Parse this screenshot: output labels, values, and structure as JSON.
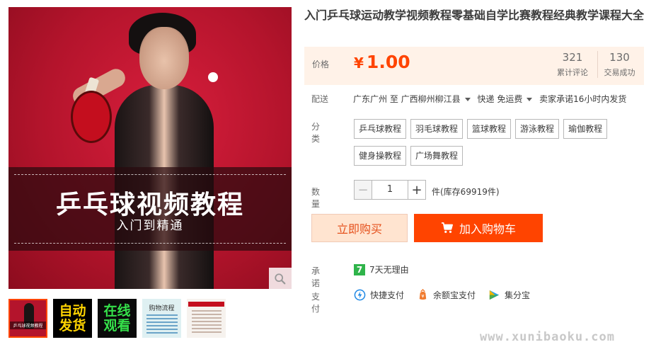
{
  "product": {
    "title": "入门乒乓球运动教学视频教程零基础自学比赛教程经典教学课程大全",
    "image_banner": {
      "title": "乒乓球视频教程",
      "subtitle": "入门到精通"
    },
    "thumbnails": [
      {
        "name": "main-photo",
        "caption": "乒乓球视频教程"
      },
      {
        "name": "auto-delivery",
        "line1": "自动",
        "line2": "发货"
      },
      {
        "name": "online-watch",
        "line1": "在线",
        "line2": "观看"
      },
      {
        "name": "purchase-flow",
        "caption": "购物流程"
      },
      {
        "name": "detail-page",
        "caption": ""
      }
    ]
  },
  "price": {
    "label": "价格",
    "currency": "¥",
    "amount": "1.00",
    "reviews_count": "321",
    "reviews_label": "累计评论",
    "sales_count": "130",
    "sales_label": "交易成功"
  },
  "shipping": {
    "label": "配送",
    "from": "广东广州 至",
    "to": "广西柳州柳江县",
    "method": "快递 免运费",
    "promise": "卖家承诺16小时内发货"
  },
  "category": {
    "label": "分类",
    "options": [
      "乒乓球教程",
      "羽毛球教程",
      "篮球教程",
      "游泳教程",
      "瑜伽教程",
      "健身操教程",
      "广场舞教程"
    ]
  },
  "quantity": {
    "label": "数量",
    "value": "1",
    "minus": "−",
    "plus": "+",
    "stock_text": "件(库存69919件)"
  },
  "actions": {
    "buy_now": "立即购买",
    "add_to_cart": "加入购物车"
  },
  "promise": {
    "label": "承诺",
    "badge": "7",
    "text": "7天无理由"
  },
  "payment": {
    "label": "支付",
    "methods": [
      {
        "name": "快捷支付",
        "icon": "quick-pay-icon"
      },
      {
        "name": "余额宝支付",
        "icon": "yuebao-icon"
      },
      {
        "name": "集分宝",
        "icon": "jifenbao-icon"
      }
    ]
  },
  "watermark": "www.xunibaoku.com",
  "colors": {
    "accent": "#ff4400",
    "price_bg": "#fff2e8",
    "buy_bg": "#ffe4d0",
    "promise_green": "#2fb44a"
  }
}
